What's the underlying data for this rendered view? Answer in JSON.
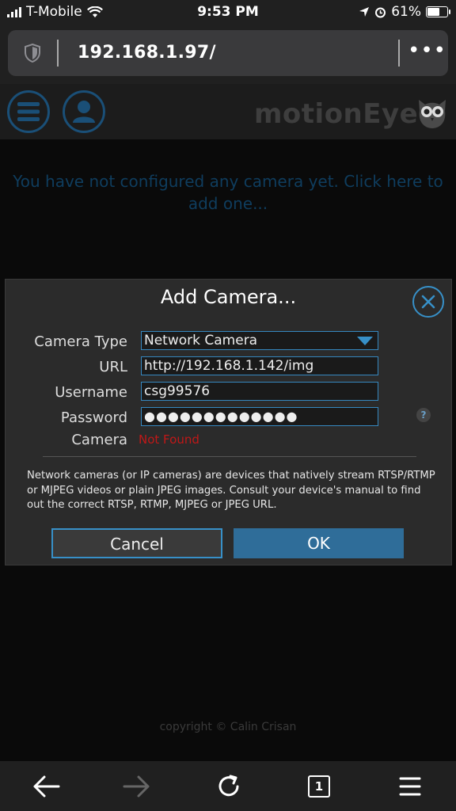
{
  "status_bar": {
    "carrier": "T-Mobile",
    "time": "9:53 PM",
    "battery": "61%",
    "battery_level": 0.61
  },
  "browser": {
    "url": "192.168.1.97/",
    "more_label": "•••"
  },
  "app": {
    "title": "motionEye",
    "notice": "You have not configured any camera yet. Click here to add one...",
    "copyright": "copyright © Calin Crisan"
  },
  "dialog": {
    "title": "Add Camera...",
    "camera_type_label": "Camera Type",
    "camera_type_value": "Network Camera",
    "url_label": "URL",
    "url_value": "http://192.168.1.142/img",
    "username_label": "Username",
    "username_value": "csg99576",
    "password_label": "Password",
    "password_value": "●●●●●●●●●●●●●",
    "help_glyph": "?",
    "camera_label": "Camera",
    "camera_status": "Not Found",
    "description": "Network cameras (or IP cameras) are devices that natively stream RTSP/RTMP or MJPEG videos or plain JPEG images. Consult your device's manual to find out the correct RTSP, RTMP, MJPEG or JPEG URL.",
    "cancel_label": "Cancel",
    "ok_label": "OK"
  },
  "toolbar": {
    "tab_count": "1"
  },
  "colors": {
    "accent": "#3790c8",
    "ok_button": "#2f6d99",
    "error": "#c01818",
    "header_icon": "#1a4f77"
  }
}
